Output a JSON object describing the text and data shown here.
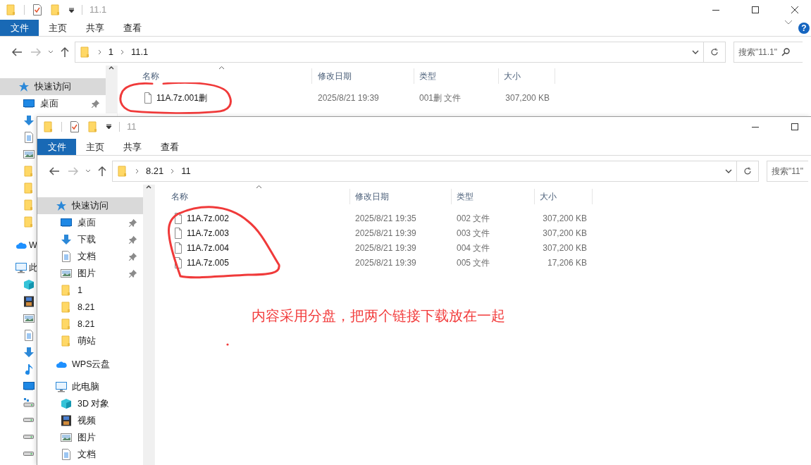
{
  "windows": [
    {
      "title": "11.1",
      "ribbon_tabs": [
        {
          "label": "文件",
          "selected": true
        },
        {
          "label": "主页",
          "selected": false
        },
        {
          "label": "共享",
          "selected": false
        },
        {
          "label": "查看",
          "selected": false
        }
      ],
      "help": "?",
      "path": [
        "1",
        "11.1"
      ],
      "search_placeholder": "搜索\"11.1\"",
      "nav_items": [
        {
          "kind": "star",
          "label": "快速访问",
          "selected": true,
          "pinned": false
        },
        {
          "kind": "desktop",
          "label": "桌面",
          "selected": false,
          "pinned": true
        },
        {
          "kind": "download",
          "selected": false
        },
        {
          "kind": "document",
          "selected": false
        },
        {
          "kind": "picture",
          "selected": false
        },
        {
          "kind": "folder",
          "selected": false
        },
        {
          "kind": "folder",
          "selected": false
        },
        {
          "kind": "folder",
          "selected": false
        },
        {
          "kind": "folder",
          "selected": false
        },
        {
          "kind": "cloud",
          "label": "W",
          "selected": false
        },
        {
          "kind": "pc",
          "label": "此",
          "selected": false
        },
        {
          "kind": "cube",
          "selected": false
        },
        {
          "kind": "film",
          "selected": false
        },
        {
          "kind": "picture",
          "selected": false
        },
        {
          "kind": "document",
          "selected": false
        },
        {
          "kind": "download",
          "selected": false
        },
        {
          "kind": "music",
          "selected": false
        },
        {
          "kind": "desktop",
          "selected": false
        },
        {
          "kind": "netdrive",
          "selected": false
        },
        {
          "kind": "drive",
          "selected": false
        },
        {
          "kind": "drive",
          "selected": false
        },
        {
          "kind": "drive",
          "selected": false
        }
      ],
      "columns": [
        "名称",
        "修改日期",
        "类型",
        "大小"
      ],
      "files": [
        {
          "name": "11A.7z.001删",
          "modified": "2025/8/21 19:39",
          "type": "001删 文件",
          "size": "307,200 KB"
        }
      ]
    },
    {
      "title": "11",
      "ribbon_tabs": [
        {
          "label": "文件",
          "selected": true
        },
        {
          "label": "主页",
          "selected": false
        },
        {
          "label": "共享",
          "selected": false
        },
        {
          "label": "查看",
          "selected": false
        }
      ],
      "path": [
        "8.21",
        "11"
      ],
      "search_placeholder": "搜索\"11\"",
      "nav_items": [
        {
          "kind": "star",
          "label": "快速访问",
          "selected": true,
          "pinned": false
        },
        {
          "kind": "desktop",
          "label": "桌面",
          "selected": false,
          "pinned": true
        },
        {
          "kind": "download",
          "label": "下载",
          "selected": false,
          "pinned": true
        },
        {
          "kind": "document",
          "label": "文档",
          "selected": false,
          "pinned": true
        },
        {
          "kind": "picture",
          "label": "图片",
          "selected": false,
          "pinned": true
        },
        {
          "kind": "folder",
          "label": "1",
          "selected": false,
          "pinned": false
        },
        {
          "kind": "folder",
          "label": "8.21",
          "selected": false,
          "pinned": false
        },
        {
          "kind": "folder",
          "label": "8.21",
          "selected": false,
          "pinned": false
        },
        {
          "kind": "folder",
          "label": "萌站",
          "selected": false,
          "pinned": false
        },
        {
          "kind": "cloud",
          "label": "WPS云盘",
          "selected": false,
          "pinned": false
        },
        {
          "kind": "pc",
          "label": "此电脑",
          "selected": false,
          "pinned": false
        },
        {
          "kind": "cube",
          "label": "3D 对象",
          "selected": false,
          "pinned": false
        },
        {
          "kind": "film",
          "label": "视频",
          "selected": false,
          "pinned": false
        },
        {
          "kind": "picture",
          "label": "图片",
          "selected": false,
          "pinned": false
        },
        {
          "kind": "document",
          "label": "文档",
          "selected": false,
          "pinned": false
        }
      ],
      "columns": [
        "名称",
        "修改日期",
        "类型",
        "大小"
      ],
      "files": [
        {
          "name": "11A.7z.002",
          "modified": "2025/8/21 19:35",
          "type": "002 文件",
          "size": "307,200 KB"
        },
        {
          "name": "11A.7z.003",
          "modified": "2025/8/21 19:39",
          "type": "003 文件",
          "size": "307,200 KB"
        },
        {
          "name": "11A.7z.004",
          "modified": "2025/8/21 19:39",
          "type": "004 文件",
          "size": "307,200 KB"
        },
        {
          "name": "11A.7z.005",
          "modified": "2025/8/21 19:39",
          "type": "005 文件",
          "size": "17,206 KB"
        }
      ]
    }
  ],
  "annotation": {
    "note": "内容采用分盘，把两个链接下载放在一起"
  }
}
